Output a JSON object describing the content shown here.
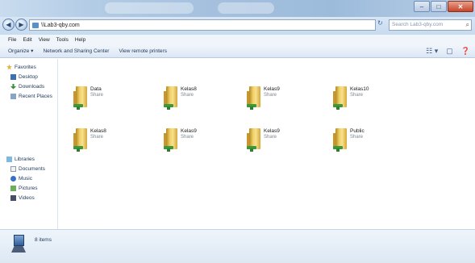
{
  "window": {
    "controls": {
      "minimize": "–",
      "maximize": "□",
      "close": "✕"
    }
  },
  "address": {
    "back_glyph": "◀",
    "forward_glyph": "▶",
    "path": "\\\\Lab3-qby.com",
    "refresh_glyph": "↻",
    "search_placeholder": "Search Lab3-qby.com",
    "search_glyph": "⌕"
  },
  "menu": [
    "File",
    "Edit",
    "View",
    "Tools",
    "Help"
  ],
  "toolbar": {
    "organize": "Organize ▾",
    "network_sharing": "Network and Sharing Center",
    "view_printers": "View remote printers",
    "view_glyph": "☷ ▾",
    "pane_glyph": "▢",
    "help_glyph": "❓"
  },
  "nav": {
    "favorites": [
      {
        "label": "Favorites",
        "icon": "star-icon"
      },
      {
        "label": "Desktop",
        "icon": "desktop-icon"
      },
      {
        "label": "Downloads",
        "icon": "downloads-icon"
      },
      {
        "label": "Recent Places",
        "icon": "recent-places-icon"
      }
    ],
    "libraries": [
      {
        "label": "Libraries",
        "icon": "libraries-icon"
      },
      {
        "label": "Documents",
        "icon": "documents-icon"
      },
      {
        "label": "Music",
        "icon": "music-icon"
      },
      {
        "label": "Pictures",
        "icon": "pictures-icon"
      },
      {
        "label": "Videos",
        "icon": "videos-icon"
      }
    ]
  },
  "shares": [
    {
      "name": "Data",
      "type": "Share"
    },
    {
      "name": "Kelas8",
      "type": "Share"
    },
    {
      "name": "Kelas9",
      "type": "Share"
    },
    {
      "name": "Kelas10",
      "type": "Share"
    },
    {
      "name": "Kelas8",
      "type": "Share"
    },
    {
      "name": "Kelas9",
      "type": "Share"
    },
    {
      "name": "Kelas9",
      "type": "Share"
    },
    {
      "name": "Public",
      "type": "Share"
    }
  ],
  "details": {
    "count": "8 items"
  },
  "colors": {
    "title_bar": "#a4c0de",
    "folder": "#f2d26a",
    "network_badge": "#3a9a3a",
    "close_button": "#c6452a"
  }
}
